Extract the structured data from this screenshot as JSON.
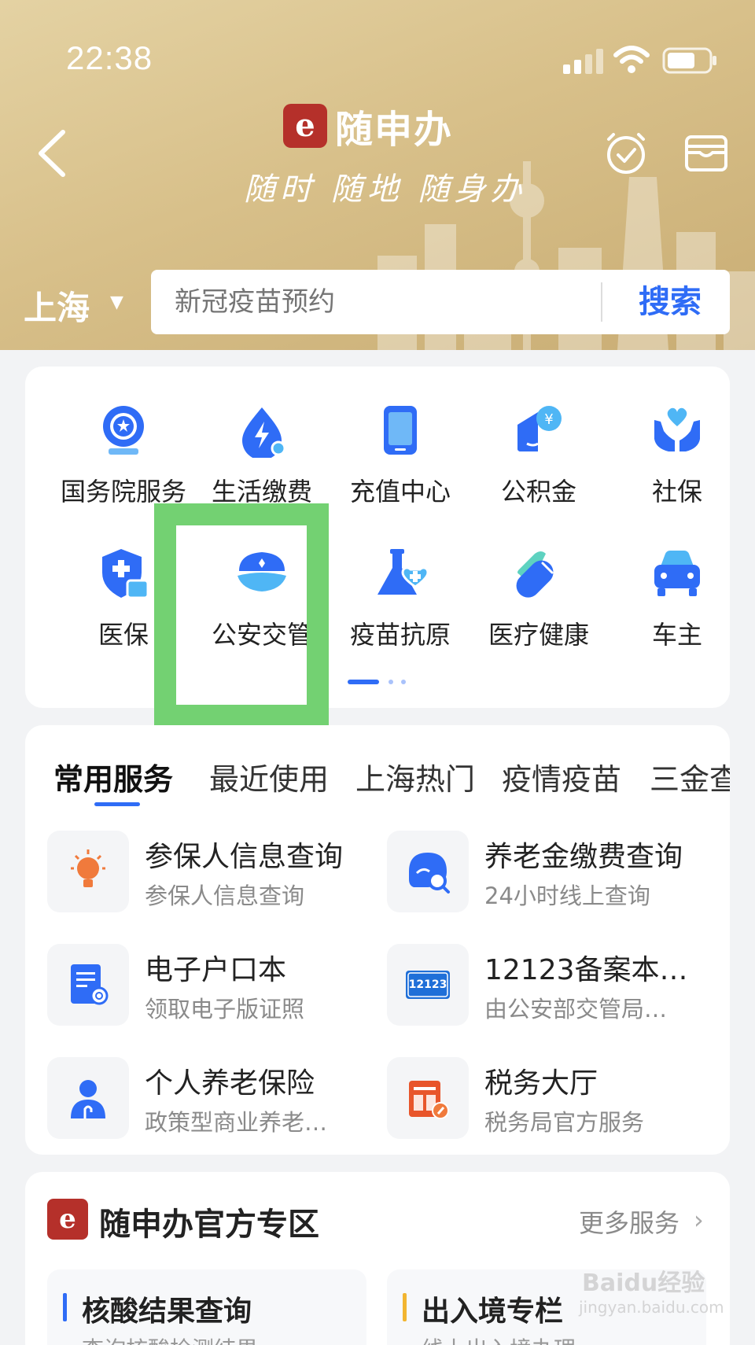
{
  "status_bar": {
    "time": "22:38"
  },
  "header": {
    "logo_mark": "e",
    "app_name": "随申办",
    "slogan": "随时 随地 随身办",
    "city": "上海",
    "search": {
      "placeholder": "新冠疫苗预约",
      "button": "搜索"
    }
  },
  "grid": {
    "items": [
      {
        "label": "国务院服务",
        "icon": "state-council-icon"
      },
      {
        "label": "生活缴费",
        "icon": "bolt-drop-icon"
      },
      {
        "label": "充值中心",
        "icon": "tablet-icon"
      },
      {
        "label": "公积金",
        "icon": "fund-icon"
      },
      {
        "label": "社保",
        "icon": "heart-hands-icon"
      },
      {
        "label": "医保",
        "icon": "medical-shield-icon"
      },
      {
        "label": "公安交管",
        "icon": "police-cap-icon"
      },
      {
        "label": "疫苗抗原",
        "icon": "flask-icon"
      },
      {
        "label": "医疗健康",
        "icon": "pill-icon"
      },
      {
        "label": "车主",
        "icon": "car-icon"
      }
    ],
    "page_index": 1,
    "page_count": 3
  },
  "tabs": [
    "常用服务",
    "最近使用",
    "上海热门",
    "疫情疫苗",
    "三金查询"
  ],
  "services": [
    {
      "title": "参保人信息查询",
      "subtitle": "参保人信息查询",
      "icon": "bulb-icon"
    },
    {
      "title": "养老金缴费查询",
      "subtitle": "24小时线上查询",
      "icon": "pension-search-icon"
    },
    {
      "title": "电子户口本",
      "subtitle": "领取电子版证照",
      "icon": "document-search-icon"
    },
    {
      "title": "12123备案本…",
      "subtitle": "由公安部交管局…",
      "icon": "12123-icon",
      "icon_text": "12123"
    },
    {
      "title": "个人养老保险",
      "subtitle": "政策型商业养老…",
      "icon": "person-icon"
    },
    {
      "title": "税务大厅",
      "subtitle": "税务局官方服务",
      "icon": "tax-icon"
    }
  ],
  "official_zone": {
    "logo_mark": "e",
    "title": "随申办官方专区",
    "more": "更多服务",
    "items": [
      {
        "title": "核酸结果查询",
        "subtitle": "查询核酸检测结果",
        "accent": "#2f6cf6"
      },
      {
        "title": "出入境专栏",
        "subtitle": "线上出入境办理",
        "accent": "#f2b530"
      }
    ]
  },
  "watermark": {
    "brand": "Baidu经验",
    "url": "jingyan.baidu.com"
  },
  "colors": {
    "accent": "#2f6cf6",
    "highlight": "#73d172",
    "header": "#d8c08a"
  }
}
